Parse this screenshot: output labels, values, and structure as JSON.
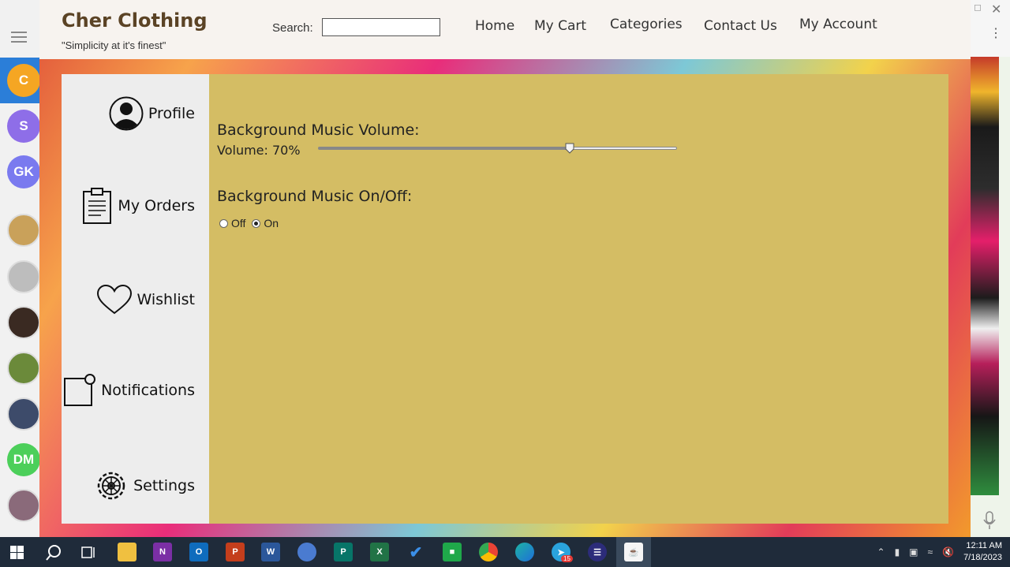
{
  "app": {
    "title": "Cher Clothing",
    "tagline": "\"Simplicity at it's finest\"",
    "search": {
      "label": "Search:",
      "value": "",
      "placeholder": ""
    },
    "nav": [
      "Home",
      "My Cart",
      "Categories",
      "Contact Us",
      "My Account"
    ]
  },
  "sidebar": {
    "items": [
      {
        "label": "Profile",
        "icon": "user-silhouette-icon"
      },
      {
        "label": "My Orders",
        "icon": "clipboard-icon"
      },
      {
        "label": "Wishlist",
        "icon": "heart-icon"
      },
      {
        "label": "Notifications",
        "icon": "notification-icon"
      },
      {
        "label": "Settings",
        "icon": "gear-icon"
      }
    ]
  },
  "settings": {
    "volume_heading": "Background Music Volume:",
    "volume_label": "Volume: 70%",
    "volume_value": 70,
    "toggle_heading": "Background Music On/Off:",
    "options": [
      {
        "label": "Off",
        "checked": false
      },
      {
        "label": "On",
        "checked": true
      }
    ]
  },
  "left_rail": {
    "avatars": [
      {
        "text": "C",
        "color": "#f5a623"
      },
      {
        "text": "S",
        "color": "#8e6ee8"
      },
      {
        "text": "GK",
        "color": "#7a7aef"
      },
      {
        "text": "",
        "color": "#c9a15a"
      },
      {
        "text": "",
        "color": "#bdbdbd"
      },
      {
        "text": "",
        "color": "#3a2a22"
      },
      {
        "text": "",
        "color": "#6b8a3a"
      },
      {
        "text": "",
        "color": "#3d4b6a"
      },
      {
        "text": "DM",
        "color": "#4ccf5a"
      },
      {
        "text": "",
        "color": "#8a6a7a"
      }
    ]
  },
  "taskbar": {
    "time": "12:11 AM",
    "date": "7/18/2023",
    "badge": "15"
  },
  "colors": {
    "header_bg": "#f7f3ef",
    "brand": "#5b4325",
    "content_bg": "#d4bd64",
    "panel_bg": "#ededed"
  }
}
